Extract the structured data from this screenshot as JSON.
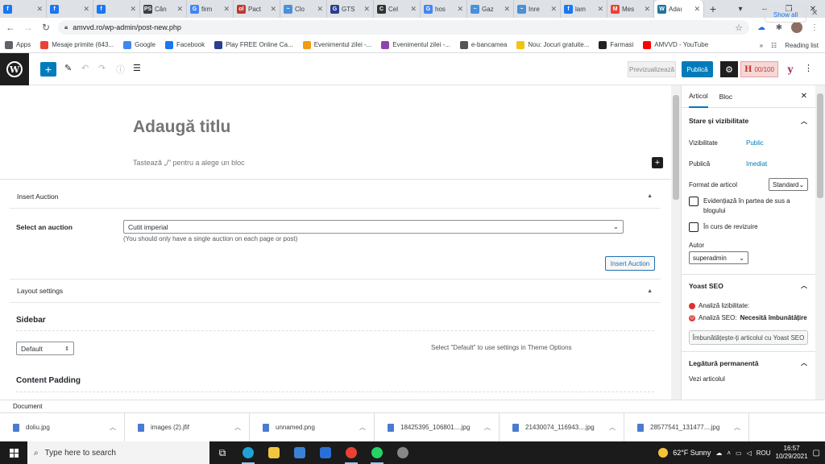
{
  "browser": {
    "tabs": [
      {
        "title": "",
        "color": "#1877f2",
        "glyph": "f"
      },
      {
        "title": "",
        "color": "#1877f2",
        "glyph": "f"
      },
      {
        "title": "",
        "color": "#1877f2",
        "glyph": "f"
      },
      {
        "title": "Căn",
        "color": "#3c4043",
        "glyph": "PS"
      },
      {
        "title": "firm",
        "color": "#4285f4",
        "glyph": "G"
      },
      {
        "title": "Pact",
        "color": "#c0392b",
        "glyph": "ol"
      },
      {
        "title": "Clo",
        "color": "#4a90d9",
        "glyph": "~"
      },
      {
        "title": "GTS",
        "color": "#2c3e8f",
        "glyph": "G"
      },
      {
        "title": "Cel",
        "color": "#333333",
        "glyph": "C"
      },
      {
        "title": "hos",
        "color": "#4285f4",
        "glyph": "G"
      },
      {
        "title": "Gaz",
        "color": "#4a90d9",
        "glyph": "~"
      },
      {
        "title": "Inre",
        "color": "#4a90d9",
        "glyph": "~"
      },
      {
        "title": "lam",
        "color": "#1877f2",
        "glyph": "f"
      },
      {
        "title": "Mes",
        "color": "#ea4335",
        "glyph": "M"
      },
      {
        "title": "Adaı",
        "color": "#21759b",
        "glyph": "W"
      }
    ],
    "new_tab": "+",
    "url": "amvvd.ro/wp-admin/post-new.php",
    "bookmarks": [
      {
        "label": "Apps",
        "color": "#5f6368"
      },
      {
        "label": "Mesaje primite (643...",
        "color": "#ea4335"
      },
      {
        "label": "Google",
        "color": "#4285f4"
      },
      {
        "label": "Facebook",
        "color": "#1877f2"
      },
      {
        "label": "Play FREE Online Ca...",
        "color": "#2c3e8f"
      },
      {
        "label": "Evenimentul zilei -...",
        "color": "#f39c12"
      },
      {
        "label": "Evenimentul zilei -...",
        "color": "#8e44ad"
      },
      {
        "label": "e-bancamea",
        "color": "#555555"
      },
      {
        "label": "Nou: Jocuri gratuite...",
        "color": "#f1c40f"
      },
      {
        "label": "Farmasi",
        "color": "#222222"
      },
      {
        "label": "AMVVD - YouTube",
        "color": "#ff0000"
      }
    ],
    "more": "»",
    "reading_list": "Reading list"
  },
  "wp": {
    "toolbar": {
      "add": "+",
      "preview": "Previzualizează",
      "publish": "Publică",
      "score": "00/100",
      "yoast": "y",
      "more": "⋮"
    },
    "editor": {
      "title_placeholder": "Adaugă titlu",
      "block_placeholder": "Tastează „/” pentru a alege un bloc",
      "insert_auction_title": "Insert Auction",
      "select_auction_label": "Select an auction",
      "auction_value": "Cutit imperial",
      "auction_hint": "(You should only have a single auction on each page or post)",
      "insert_button": "Insert Auction",
      "layout_title": "Layout settings",
      "sidebar_title": "Sidebar",
      "sidebar_value": "Default",
      "sidebar_hint": "Select \"Default\" to use settings in Theme Options",
      "content_padding_title": "Content Padding"
    },
    "sidebar": {
      "tabs": [
        "Articol",
        "Bloc"
      ],
      "status_title": "Stare și vizibilitate",
      "visibility_label": "Vizibilitate",
      "visibility_value": "Public",
      "publish_label": "Publică",
      "publish_value": "Imediat",
      "format_label": "Format de articol",
      "format_value": "Standard",
      "sticky_label": "Evidențiază în partea de sus a blogului",
      "review_label": "În curs de revizuire",
      "author_label": "Autor",
      "author_value": "superadmin",
      "yoast_title": "Yoast SEO",
      "readability": "Analiză lizibilitate:",
      "seo_prefix": "Analiză SEO:",
      "seo_status": "Necesită îmbunătățire",
      "seo_button": "Îmbunătățește-ți articolul cu Yoast SEO",
      "permalink_title": "Legătură permanentă",
      "view_post": "Vezi articolul"
    },
    "footer": "Document"
  },
  "downloads": {
    "files": [
      "doliu.jpg",
      "images (2).jfif",
      "unnamed.png",
      "18425395_106801....jpg",
      "21430074_116943....jpg",
      "28577541_131477....jpg"
    ],
    "show_all": "Show all"
  },
  "taskbar": {
    "search_placeholder": "Type here to search",
    "weather": "62°F  Sunny",
    "lang": "ROU",
    "time": "16:57",
    "date": "10/29/2021"
  }
}
